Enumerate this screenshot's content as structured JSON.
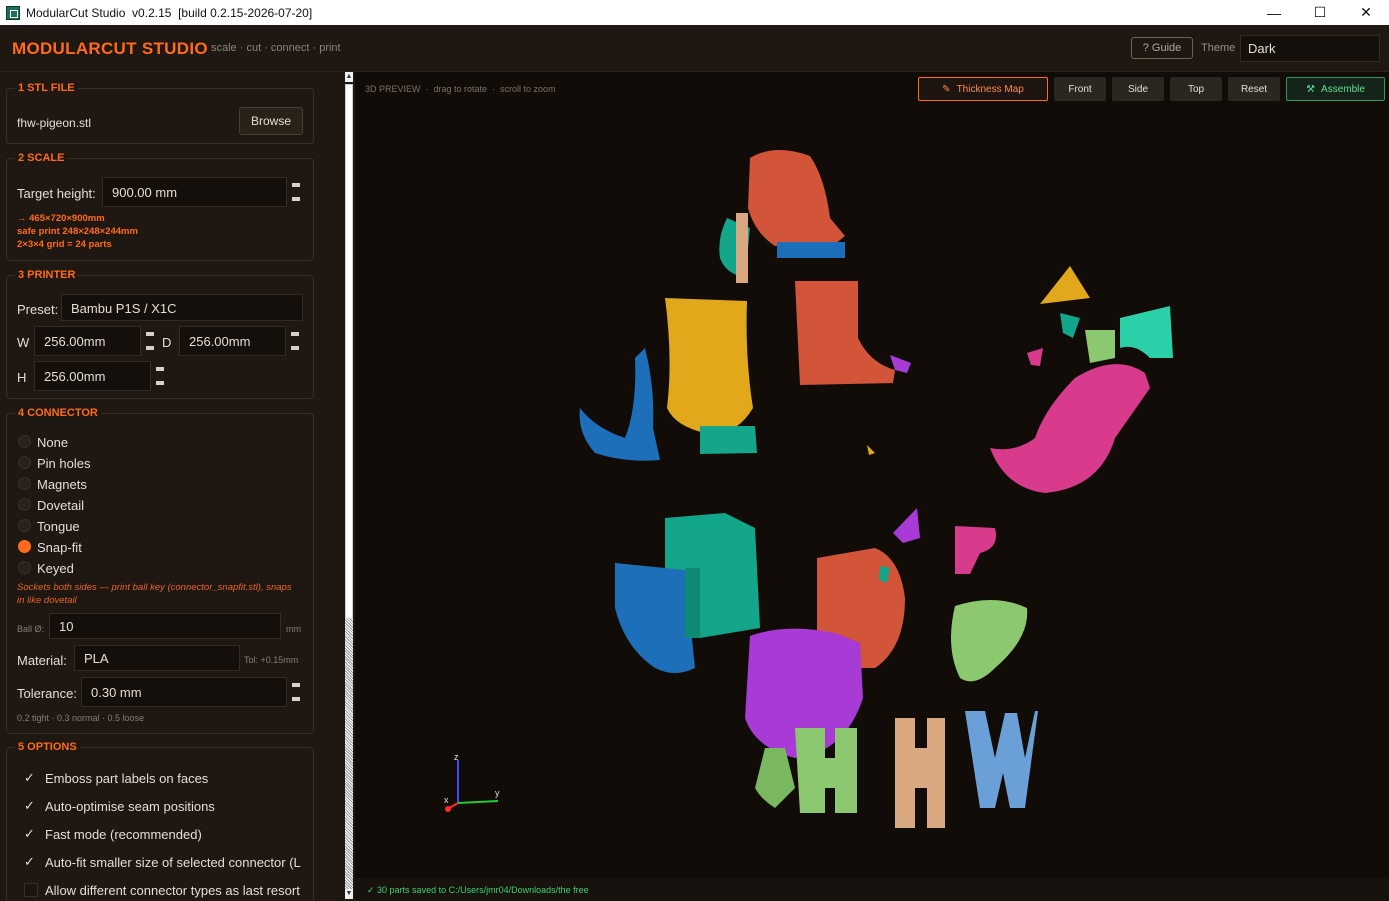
{
  "window": {
    "title": "ModularCut Studio  v0.2.15  [build 0.2.15-2026-07-20]",
    "minimize": "—",
    "maximize": "☐",
    "close": "✕"
  },
  "header": {
    "brand": "MODULARCUT STUDIO",
    "tagline": "scale · cut · connect · print",
    "guide": "? Guide",
    "theme_label": "Theme",
    "theme_value": "Dark"
  },
  "stl": {
    "title": "1  STL FILE",
    "filename": "fhw-pigeon.stl",
    "browse": "Browse"
  },
  "scale": {
    "title": "2  SCALE",
    "target_label": "Target height:",
    "target_value": "900.00 mm",
    "dims": "→ 465×720×900mm",
    "safe": "safe print 248×248×244mm",
    "grid": "2×3×4 grid = 24 parts"
  },
  "printer": {
    "title": "3  PRINTER",
    "preset_label": "Preset:",
    "preset_value": "Bambu P1S / X1C",
    "w_label": "W",
    "w_value": "256.00mm",
    "d_label": "D",
    "d_value": "256.00mm",
    "h_label": "H",
    "h_value": "256.00mm"
  },
  "connector": {
    "title": "4  CONNECTOR",
    "options": [
      {
        "label": "None",
        "selected": false
      },
      {
        "label": "Pin holes",
        "selected": false
      },
      {
        "label": "Magnets",
        "selected": false
      },
      {
        "label": "Dovetail",
        "selected": false
      },
      {
        "label": "Tongue",
        "selected": false
      },
      {
        "label": "Snap-fit",
        "selected": true
      },
      {
        "label": "Keyed",
        "selected": false
      }
    ],
    "note_line1": "Sockets both sides — print ball key (connector_snapfit.stl), snaps",
    "note_line2": "in like dovetail",
    "ball_label": "Ball Ø:",
    "ball_value": "10",
    "ball_unit": "mm",
    "material_label": "Material:",
    "material_value": "PLA",
    "tol_hint": "Tol: +0.15mm",
    "tolerance_label": "Tolerance:",
    "tolerance_value": "0.30 mm",
    "tolerance_hint": "0.2 tight · 0.3 normal · 0.5 loose"
  },
  "options": {
    "title": "5  OPTIONS",
    "items": [
      {
        "label": "Emboss part labels on faces",
        "checked": true
      },
      {
        "label": "Auto-optimise seam positions",
        "checked": true
      },
      {
        "label": "Fast mode (recommended)",
        "checked": true
      },
      {
        "label": "Auto-fit smaller size of selected connector (L",
        "checked": true
      },
      {
        "label": "Allow different connector types as last resort",
        "checked": false
      }
    ]
  },
  "preview": {
    "head": "3D PREVIEW  ·  drag to rotate  ·  scroll to zoom",
    "thickness": "Thickness Map",
    "front": "Front",
    "side": "Side",
    "top": "Top",
    "reset": "Reset",
    "assemble": "Assemble",
    "status": "✓  30 parts saved to C:/Users/jmr04/Downloads/the free",
    "axes": {
      "z": "z",
      "y": "y",
      "x": "x"
    }
  },
  "colors": {
    "accent": "#ff6b1a",
    "success": "#3fd16f",
    "part_orange": "#d2553a",
    "part_blue": "#1c6fb8",
    "part_teal": "#14a68a",
    "part_yellow": "#e0a81a",
    "part_magenta": "#d83a8c",
    "part_purple": "#a83ad6",
    "part_green": "#8cc870",
    "part_lightblue": "#6a9fd8",
    "part_tan": "#d8a880"
  }
}
